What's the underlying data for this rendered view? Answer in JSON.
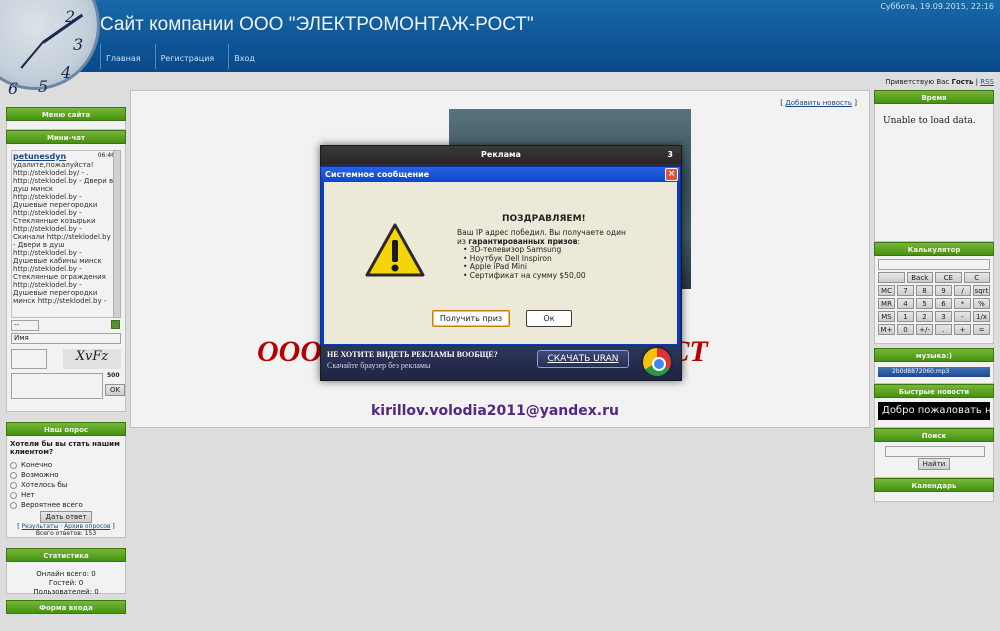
{
  "header": {
    "date": "Суббота, 19.09.2015, 22:16",
    "site_title": "Сайт компании ООО \"ЭЛЕКТРОМОНТАЖ-РОСТ\"",
    "nav": [
      "Главная",
      "Регистрация",
      "Вход"
    ],
    "clock_numbers": [
      "2",
      "3",
      "4",
      "5",
      "6"
    ]
  },
  "greeting": {
    "prefix": "Приветствую Вас",
    "user": "Гость",
    "rss": "RSS"
  },
  "left": {
    "menu_title": "Меню сайта",
    "chat_title": "Мини-чат",
    "chat_user": "petunesdyn",
    "chat_time": "06:46",
    "chat_message": "удалите,пожалуйста! http://steklodel.by/ - . http://steklodel.by - Двери в душ минск http://steklodel.by - Душевые перегородки http://steklodel.by - Стеклянные козырьки http://steklodel.by - Скинали http://steklodel.by - Двери в душ http://steklodel.by - Душевые кабины минск http://steklodel.by - Стеклянные ограждения http://steklodel.by - Душевые перегородки минск http://steklodel.by -",
    "chat_select": "--",
    "chat_name_placeholder": "Имя",
    "chat_counter": "500",
    "chat_ok": "OK",
    "captcha_text": "XvFz",
    "poll_title": "Наш опрос",
    "poll_question": "Хотели бы вы стать нашим клиентом?",
    "poll_options": [
      "Конечно",
      "Возможно",
      "Хотелось бы",
      "Нет",
      "Вероятнее всего"
    ],
    "poll_button": "Дать ответ",
    "poll_links": [
      "Результаты",
      "Архив опросов"
    ],
    "poll_total": "Всего ответов: 153",
    "stats_title": "Статистика",
    "stats": [
      "Онлайн всего: 0",
      "Гостей: 0",
      "Пользователей: 0"
    ],
    "login_title": "Форма входа"
  },
  "content": {
    "add_news": "Добавить новость",
    "company_text": "ООО \"ЭЛЕКТРОМОНТАЖ-РОСТ",
    "email": "kirillov.volodia2011@yandex.ru"
  },
  "right": {
    "time_title": "Время",
    "time_text": "Unable to load data.",
    "calc_title": "Калькулятор",
    "calc_rows": [
      [
        "",
        "Back",
        "CE",
        "C"
      ],
      [
        "MC",
        "7",
        "8",
        "9",
        "/",
        "sqrt"
      ],
      [
        "MR",
        "4",
        "5",
        "6",
        "*",
        "%"
      ],
      [
        "MS",
        "1",
        "2",
        "3",
        "-",
        "1/x"
      ],
      [
        "M+",
        "0",
        "+/-",
        ".",
        "+",
        "="
      ]
    ],
    "music_title": "музыка:)",
    "music_file": "2b0d8872060.mp3",
    "news_title": "Быстрые новости",
    "news_ticker": "Добро пожаловать на",
    "search_title": "Поиск",
    "search_button": "Найти",
    "calendar_title": "Календарь"
  },
  "ad": {
    "title": "Реклама",
    "counter": "3",
    "footer_question": "НЕ ХОТИТЕ ВИДЕТЬ РЕКЛАМЫ ВООБЩЕ?",
    "footer_sub": "Скачайте браузер без рекламы",
    "download_button": "СКАЧАТЬ URAN"
  },
  "dialog": {
    "title": "Системное сообщение",
    "close": "×",
    "heading": "ПОЗДРАВЛЯЕМ!",
    "line1": "Ваш IP адрес победил. Вы получаете один",
    "line2_prefix": "из",
    "line2_bold": "гарантированных призов",
    "prizes": [
      "• 3D-телевизор Samsung",
      "• Ноутбук Dell Inspiron",
      "• Apple iPad Mini",
      "• Сертификат на сумму $50,00"
    ],
    "btn_prize": "Получить приз",
    "btn_ok": "Ок"
  }
}
